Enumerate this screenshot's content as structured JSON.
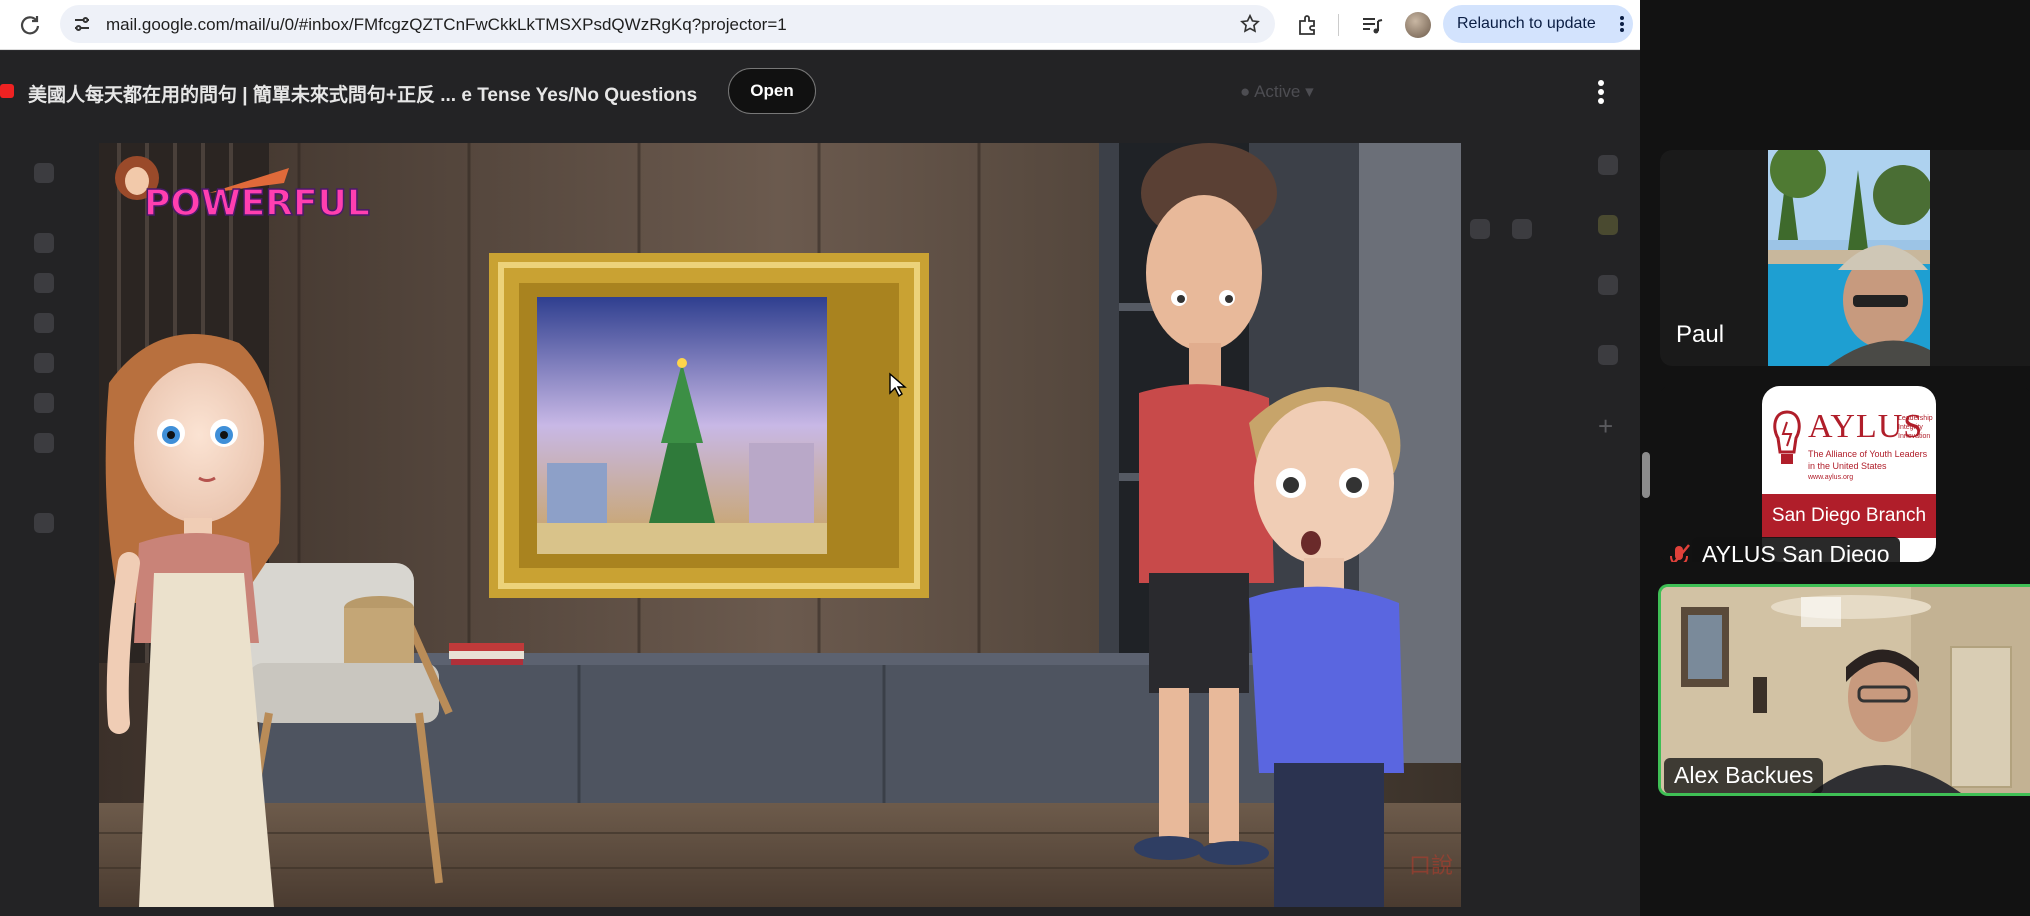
{
  "browser": {
    "url": "mail.google.com/mail/u/0/#inbox/FMfcgzQZTCnFwCkkLkTMSXPsdQWzRgKq?projector=1",
    "relaunch_label": "Relaunch to update",
    "icons": [
      "reload-icon",
      "site-settings-icon",
      "bookmark-star-icon",
      "extensions-icon",
      "media-control-icon",
      "profile-avatar",
      "more-menu-icon"
    ]
  },
  "viewer": {
    "video_title": "美國人每天都在用的問句 | 簡單未來式問句+正反 ... e Tense Yes/No Questions",
    "open_label": "Open",
    "gmail_status": "Active",
    "video_logo_text": "POWERFUL",
    "video_watermark": "口說"
  },
  "zoom": {
    "participants": [
      {
        "name": "Paul",
        "muted": false,
        "active_speaker": false
      },
      {
        "name": "AYLUS San Diego",
        "muted": true,
        "active_speaker": false,
        "logo_lines": [
          "AYLUS",
          "The Alliance of Youth Leaders",
          "in the United States",
          "www.aylus.org",
          "San Diego Branch"
        ],
        "logo_side_lines": [
          "Leadership",
          "Integrity",
          "Innovation"
        ]
      },
      {
        "name": "Alex Backues",
        "muted": false,
        "active_speaker": true
      }
    ],
    "colors": {
      "active_border": "#3fbf55",
      "mute_red": "#e0413a",
      "aylus_red": "#b01e2a"
    }
  }
}
